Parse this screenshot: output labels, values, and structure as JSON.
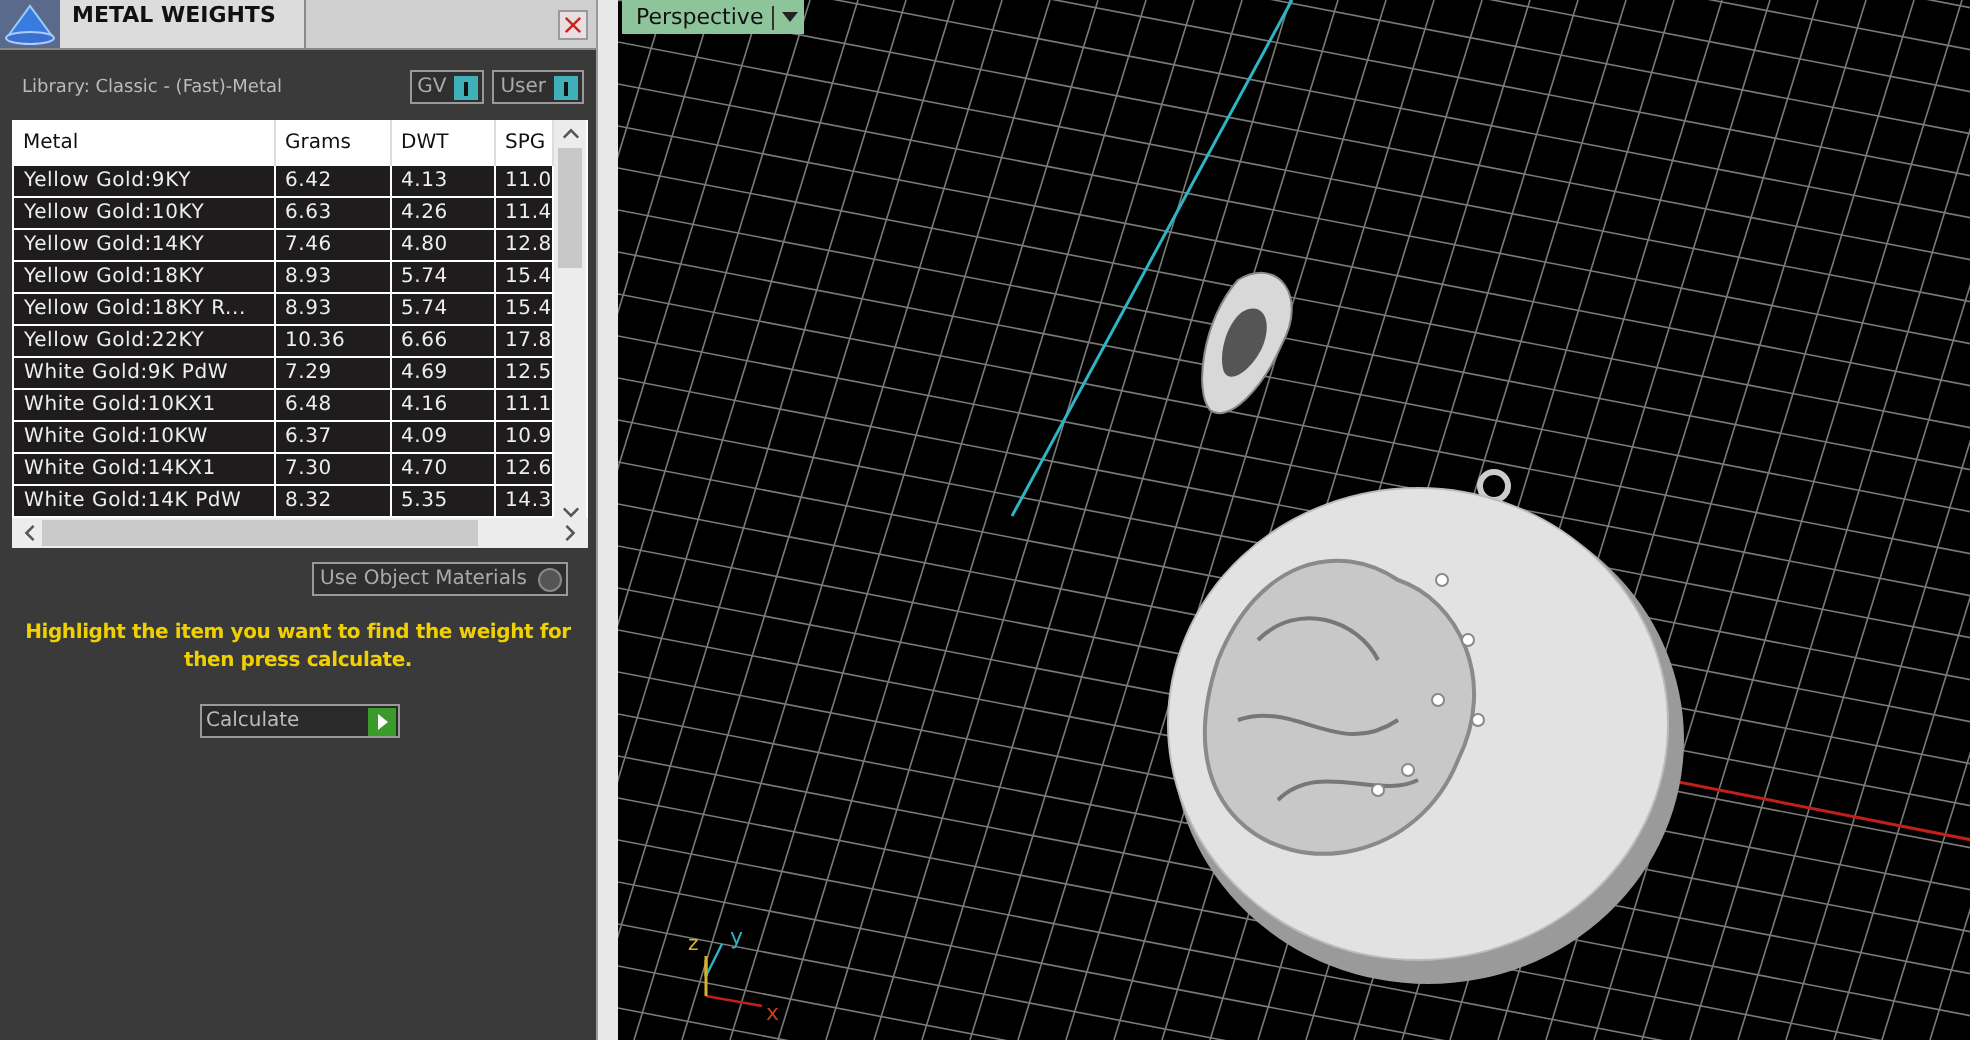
{
  "panel": {
    "title": "METAL WEIGHTS",
    "library": "Library: Classic - (Fast)-Metal",
    "toggles": [
      {
        "label": "GV",
        "on": true
      },
      {
        "label": "User",
        "on": true
      }
    ],
    "table": {
      "columns": [
        "Metal",
        "Grams",
        "DWT",
        "SPG"
      ],
      "rows": [
        [
          "Yellow Gold:9KY",
          "6.42",
          "4.13",
          "11.0"
        ],
        [
          "Yellow Gold:10KY",
          "6.63",
          "4.26",
          "11.4"
        ],
        [
          "Yellow Gold:14KY",
          "7.46",
          "4.80",
          "12.8"
        ],
        [
          "Yellow Gold:18KY",
          "8.93",
          "5.74",
          "15.4"
        ],
        [
          "Yellow Gold:18KY R...",
          "8.93",
          "5.74",
          "15.4"
        ],
        [
          "Yellow Gold:22KY",
          "10.36",
          "6.66",
          "17.8"
        ],
        [
          "White Gold:9K PdW",
          "7.29",
          "4.69",
          "12.5"
        ],
        [
          "White Gold:10KX1",
          "6.48",
          "4.16",
          "11.1"
        ],
        [
          "White Gold:10KW",
          "6.37",
          "4.09",
          "10.9"
        ],
        [
          "White Gold:14KX1",
          "7.30",
          "4.70",
          "12.6"
        ],
        [
          "White Gold:14K PdW",
          "8.32",
          "5.35",
          "14.3"
        ]
      ]
    },
    "use_object_materials": {
      "label": "Use Object Materials",
      "on": false
    },
    "hint": "Highlight the item you want to find the weight for then press calculate.",
    "calculate": "Calculate"
  },
  "viewport": {
    "view": "Perspective",
    "axes": [
      "z",
      "y",
      "x"
    ]
  }
}
